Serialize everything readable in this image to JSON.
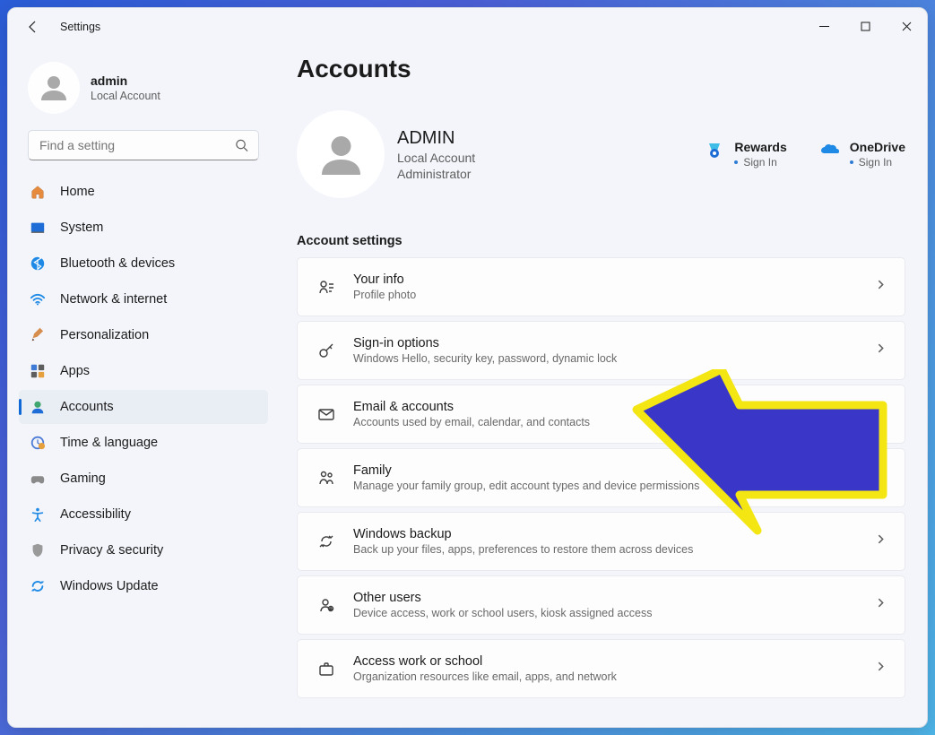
{
  "window": {
    "title": "Settings"
  },
  "user": {
    "name": "admin",
    "subtitle": "Local Account"
  },
  "search": {
    "placeholder": "Find a setting"
  },
  "nav": [
    {
      "key": "home",
      "label": "Home"
    },
    {
      "key": "system",
      "label": "System"
    },
    {
      "key": "bluetooth",
      "label": "Bluetooth & devices"
    },
    {
      "key": "network",
      "label": "Network & internet"
    },
    {
      "key": "personalization",
      "label": "Personalization"
    },
    {
      "key": "apps",
      "label": "Apps"
    },
    {
      "key": "accounts",
      "label": "Accounts",
      "active": true
    },
    {
      "key": "time",
      "label": "Time & language"
    },
    {
      "key": "gaming",
      "label": "Gaming"
    },
    {
      "key": "accessibility",
      "label": "Accessibility"
    },
    {
      "key": "privacy",
      "label": "Privacy & security"
    },
    {
      "key": "update",
      "label": "Windows Update"
    }
  ],
  "page": {
    "title": "Accounts",
    "account": {
      "name": "ADMIN",
      "line1": "Local Account",
      "line2": "Administrator"
    },
    "promos": [
      {
        "key": "rewards",
        "title": "Rewards",
        "action": "Sign In"
      },
      {
        "key": "onedrive",
        "title": "OneDrive",
        "action": "Sign In"
      }
    ],
    "section_title": "Account settings",
    "cards": [
      {
        "key": "your-info",
        "title": "Your info",
        "sub": "Profile photo"
      },
      {
        "key": "signin-options",
        "title": "Sign-in options",
        "sub": "Windows Hello, security key, password, dynamic lock"
      },
      {
        "key": "email-accounts",
        "title": "Email & accounts",
        "sub": "Accounts used by email, calendar, and contacts"
      },
      {
        "key": "family",
        "title": "Family",
        "sub": "Manage your family group, edit account types and device permissions"
      },
      {
        "key": "windows-backup",
        "title": "Windows backup",
        "sub": "Back up your files, apps, preferences to restore them across devices"
      },
      {
        "key": "other-users",
        "title": "Other users",
        "sub": "Device access, work or school users, kiosk assigned access"
      },
      {
        "key": "access-work",
        "title": "Access work or school",
        "sub": "Organization resources like email, apps, and network"
      }
    ]
  }
}
